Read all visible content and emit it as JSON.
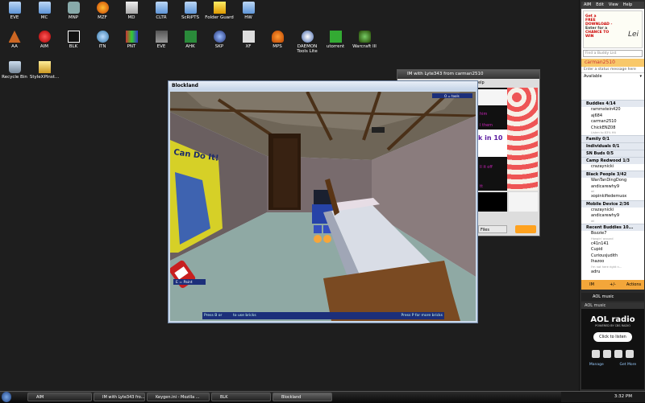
{
  "desktop": {
    "icons": [
      {
        "label": "EVE"
      },
      {
        "label": "MC"
      },
      {
        "label": "MNP"
      },
      {
        "label": "MZF"
      },
      {
        "label": "MD"
      },
      {
        "label": "CLTR"
      },
      {
        "label": "ScRiPTS"
      },
      {
        "label": "Folder Guard"
      },
      {
        "label": "HW"
      },
      {
        "label": "AA"
      },
      {
        "label": "AIM"
      },
      {
        "label": "BLK"
      },
      {
        "label": "ITN"
      },
      {
        "label": "PNT"
      },
      {
        "label": "EVE"
      },
      {
        "label": "AHK"
      },
      {
        "label": "SKP"
      },
      {
        "label": "XF"
      },
      {
        "label": "MPS"
      },
      {
        "label": "DAEMON Tools Lite"
      },
      {
        "label": "utorrent"
      },
      {
        "label": "Warcraft III"
      },
      {
        "label": "Recycle Bin"
      },
      {
        "label": "StyleXPInst..."
      }
    ]
  },
  "blockland": {
    "title": "Blockland",
    "hud_top": "O = tools",
    "hud_paint": "E = Paint",
    "poster": "Can Do It!",
    "bar_left": "Press B or",
    "bar_mid": "to use bricks",
    "bar_right": "Press P for more bricks"
  },
  "im": {
    "title": "IM with Lyte343 from carman2510",
    "menu_fragment": "elp",
    "files_btn": "Files",
    "chat_fragments": [
      "him",
      "l them",
      "k in 10",
      "ll it off",
      "tt"
    ]
  },
  "aim": {
    "menu": [
      "AIM",
      "Edit",
      "View",
      "Help"
    ],
    "ad": {
      "line1": "Get a",
      "line2": "FREE DOWNLOAD -",
      "line3": "Enter for a",
      "line4": "CHANCE TO WIN",
      "brand": "Lei"
    },
    "find_placeholder": "Find a Buddy List",
    "username": "carman2510",
    "status_prompt": "Enter a status message here",
    "availability": "Available",
    "groups": [
      {
        "name": "Buddies 4/14",
        "buddies": [
          "rammstein420",
          "aj684",
          "carman2510",
          "ChickENZ08"
        ],
        "subs": [
          "",
          "",
          "",
          "Listen to 83% Hit"
        ]
      },
      {
        "name": "Family 0/1",
        "buddies": [],
        "subs": []
      },
      {
        "name": "Individuals 0/1",
        "buddies": [],
        "subs": []
      },
      {
        "name": "SN Buds 0/5",
        "buddies": [],
        "subs": []
      },
      {
        "name": "Camp Redwood 1/3",
        "buddies": [
          "crazaynicki"
        ],
        "subs": [
          ""
        ]
      },
      {
        "name": "Black People 3/42",
        "buddies": [
          "WanTanDingDong",
          "andicarewhy9",
          "xopinkifiedemuox"
        ],
        "subs": [
          "",
          "wl",
          ""
        ]
      },
      {
        "name": "Mobile Device 2/36",
        "buddies": [
          "crazaynicki",
          "andicarewhy9"
        ],
        "subs": [
          "",
          "wl"
        ]
      },
      {
        "name": "Recent Buddies 10...",
        "buddies": [
          "Bozzie7",
          "c41n141",
          "Cupid",
          "Curiousjudith",
          "lhazoo",
          "adru"
        ],
        "subs": [
          "Hangin' around",
          "",
          "",
          "",
          "I'm not here right n...",
          ""
        ]
      }
    ],
    "bottom": [
      "IM",
      "+/-",
      "Actions"
    ],
    "music_label": "AOL music",
    "radio_header": "AOL music",
    "radio_logo": "AOL radio",
    "radio_powered": "POWERED BY CBS RADIO",
    "listen_button": "Click to listen",
    "manage": "Manage",
    "get_more": "Get More"
  },
  "taskbar": {
    "tasks": [
      "AIM",
      "IM with Lyte343 fro...",
      "Keygen.ini - Mozilla ...",
      "BLK",
      "Blockland"
    ],
    "clock": "3:32 PM"
  },
  "colors": {
    "aim_orange": "#f3a63a",
    "im_orange": "#ffa21f",
    "chat_purple": "#5a1aa0",
    "taskbar": "#111111"
  }
}
